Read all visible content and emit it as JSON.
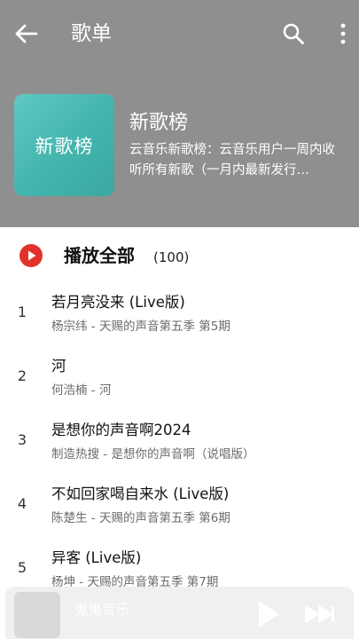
{
  "topbar": {
    "title": "歌单"
  },
  "playlist": {
    "cover_text": "新歌榜",
    "name": "新歌榜",
    "description": "云音乐新歌榜：云音乐用户一周内收听所有新歌（一月内最新发行…"
  },
  "play_all": {
    "label": "播放全部",
    "count": "(100)",
    "accent": "#e0312a"
  },
  "songs": [
    {
      "index": "1",
      "title": "若月亮没来 (Live版)",
      "subtitle": "杨宗纬 - 天赐的声音第五季 第5期"
    },
    {
      "index": "2",
      "title": "河",
      "subtitle": "何浩楠 - 河"
    },
    {
      "index": "3",
      "title": "是想你的声音啊2024",
      "subtitle": "制造热搜 - 是想你的声音啊（说唱版）"
    },
    {
      "index": "4",
      "title": "不如回家喝自来水 (Live版)",
      "subtitle": "陈楚生 - 天赐的声音第五季 第6期"
    },
    {
      "index": "5",
      "title": "异客 (Live版)",
      "subtitle": "杨坤 - 天赐的声音第五季 第7期"
    }
  ],
  "player": {
    "title": "鬼鬼音乐"
  },
  "colors": {
    "header_bg": "#8f8f8f",
    "cover_teal": "#43b5ad"
  },
  "icons": {
    "back": "back-arrow-icon",
    "search": "search-icon",
    "more": "more-vertical-icon",
    "play_all": "play-circle-icon",
    "play": "play-icon",
    "next": "skip-next-icon"
  }
}
